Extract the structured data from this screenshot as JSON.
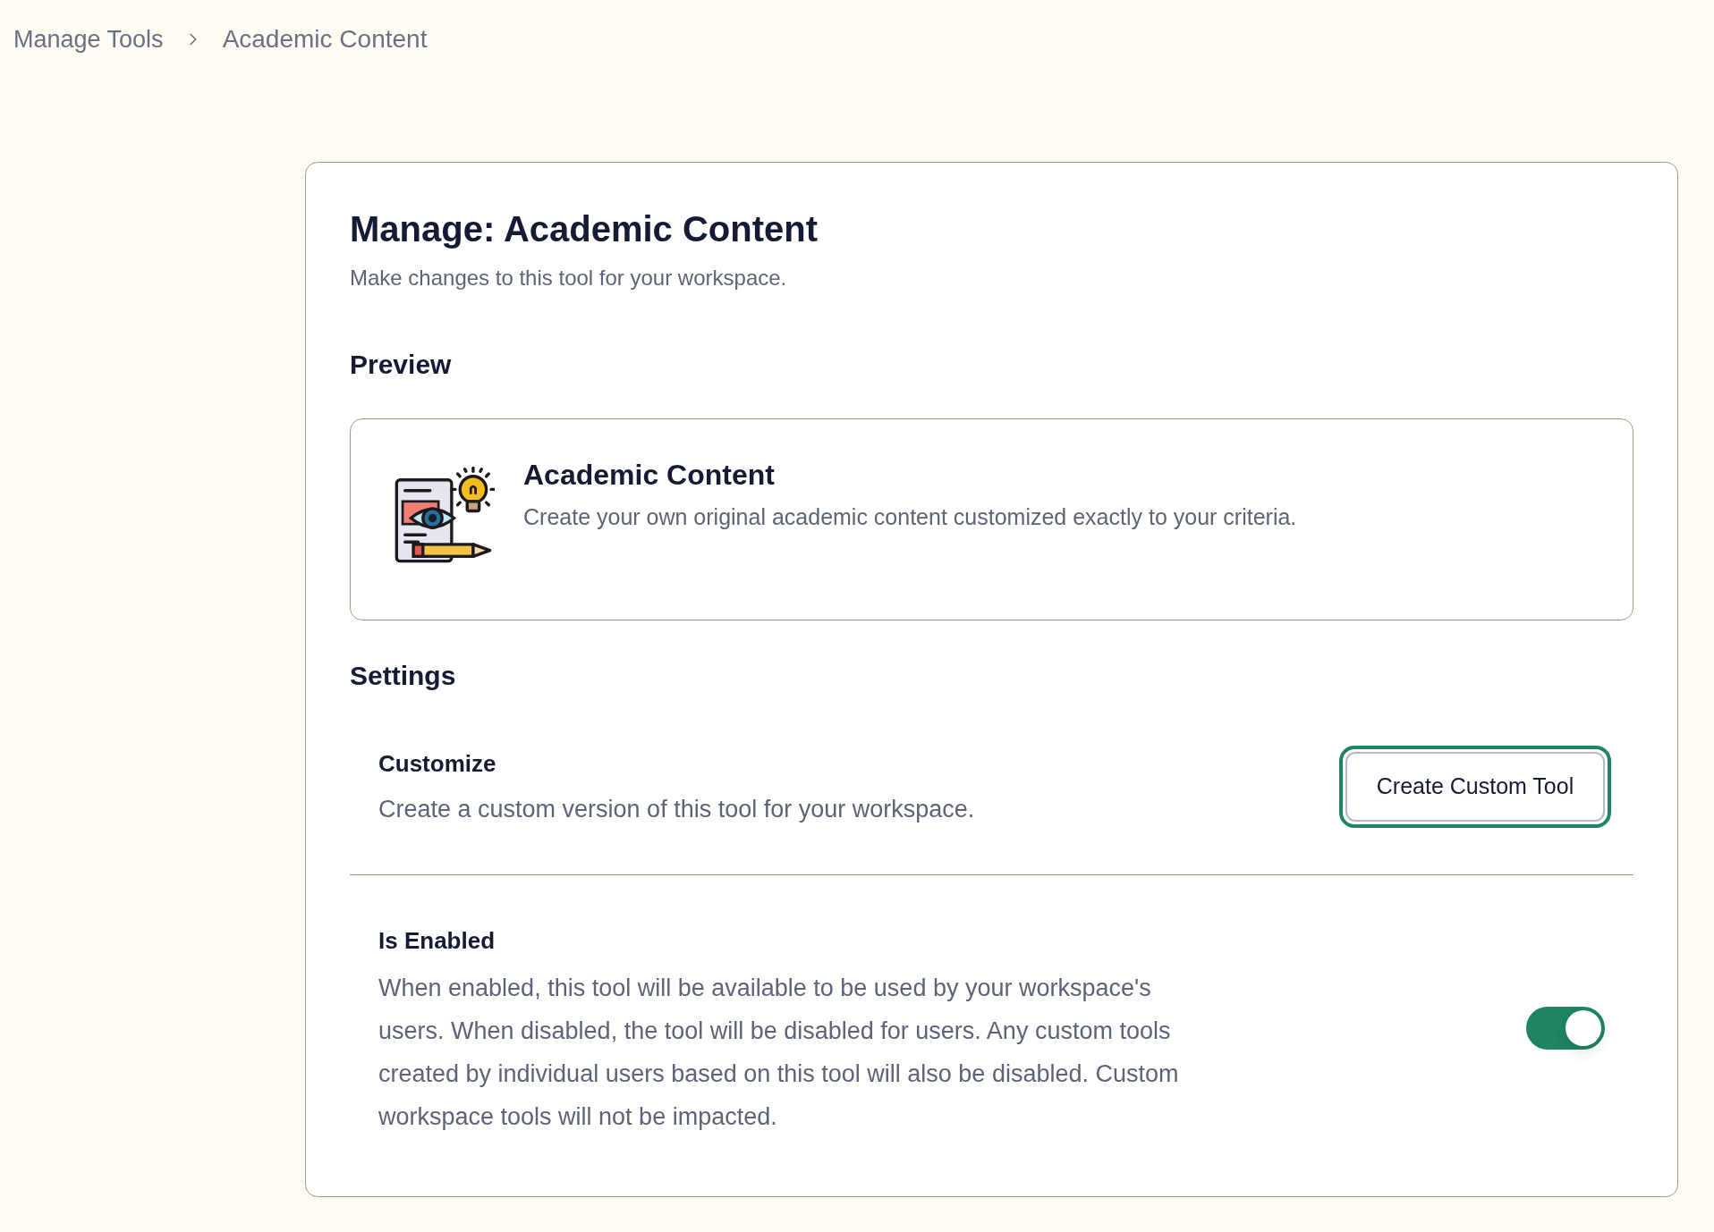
{
  "breadcrumb": [
    "Manage Tools",
    "Academic Content"
  ],
  "page": {
    "title": "Manage: Academic Content",
    "subtitle": "Make changes to this tool for your workspace."
  },
  "preview": {
    "heading": "Preview",
    "tool": {
      "name": "Academic Content",
      "description": "Create your own original academic content customized exactly to your criteria."
    }
  },
  "settings": {
    "heading": "Settings",
    "items": [
      {
        "kind": "action",
        "title": "Customize",
        "description": "Create a custom version of this tool for your workspace.",
        "button": {
          "label": "Create Custom Tool",
          "focused": true
        }
      },
      {
        "kind": "toggle",
        "title": "Is Enabled",
        "description": "When enabled, this tool will be available to be used by your workspace's users. When disabled, the tool will be disabled for users. Any custom tools created by individual users based on this tool will also be disabled. Custom workspace tools will not be impacted.",
        "on": true
      }
    ]
  }
}
